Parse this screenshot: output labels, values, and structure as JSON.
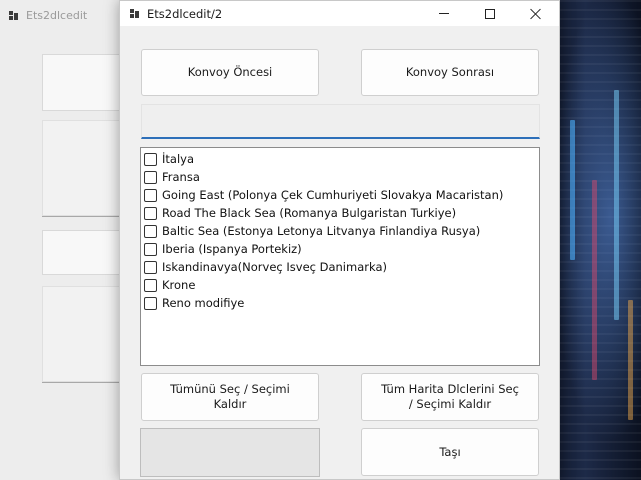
{
  "background_window": {
    "title": "Ets2dlcedit"
  },
  "dialog": {
    "title": "Ets2dlcedit/2",
    "controls": {
      "minimize_icon": "minimize-icon",
      "maximize_icon": "maximize-icon",
      "close_icon": "close-icon"
    },
    "buttons": {
      "before_convoy": "Konvoy Öncesi",
      "after_convoy": "Konvoy Sonrası",
      "select_all_toggle": "Tümünü Seç / Seçimi Kaldır",
      "select_all_maps": "Tüm Harita Dlclerini Seç / Seçimi Kaldır",
      "move": "Taşı"
    },
    "textbox_value": "",
    "dlc_list": [
      {
        "label": "İtalya",
        "checked": false
      },
      {
        "label": "Fransa",
        "checked": false
      },
      {
        "label": "Going East (Polonya Çek Cumhuriyeti Slovakya Macaristan)",
        "checked": false
      },
      {
        "label": "Road The Black Sea (Romanya Bulgaristan Turkiye)",
        "checked": false
      },
      {
        "label": "Baltic Sea (Estonya Letonya Litvanya Finlandiya Rusya)",
        "checked": false
      },
      {
        "label": "Iberia (Ispanya Portekiz)",
        "checked": false
      },
      {
        "label": "Iskandinavya(Norveç Isveç Danimarka)",
        "checked": false
      },
      {
        "label": "Krone",
        "checked": false
      },
      {
        "label": "Reno modifiye",
        "checked": false
      }
    ]
  },
  "colors": {
    "focus_accent": "#2d6fb9",
    "dialog_bg": "#f0f0f0",
    "titlebar_bg": "#ffffff"
  }
}
